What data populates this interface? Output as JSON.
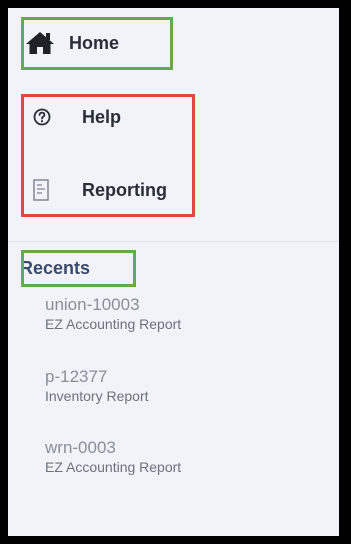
{
  "nav": {
    "home": {
      "label": "Home",
      "icon": "home-icon"
    },
    "help": {
      "label": "Help",
      "icon": "question-circle-icon"
    },
    "reporting": {
      "label": "Reporting",
      "icon": "document-icon"
    }
  },
  "recents": {
    "heading": "Recents",
    "items": [
      {
        "id": "union-10003",
        "type": "EZ Accounting Report"
      },
      {
        "id": "p-12377",
        "type": "Inventory Report"
      },
      {
        "id": "wrn-0003",
        "type": "EZ Accounting Report"
      }
    ]
  },
  "colors": {
    "panel_bg": "#f1f3f8",
    "highlight_green": "#6aa84f",
    "highlight_red": "#e04848",
    "heading": "#3a4a6b"
  }
}
